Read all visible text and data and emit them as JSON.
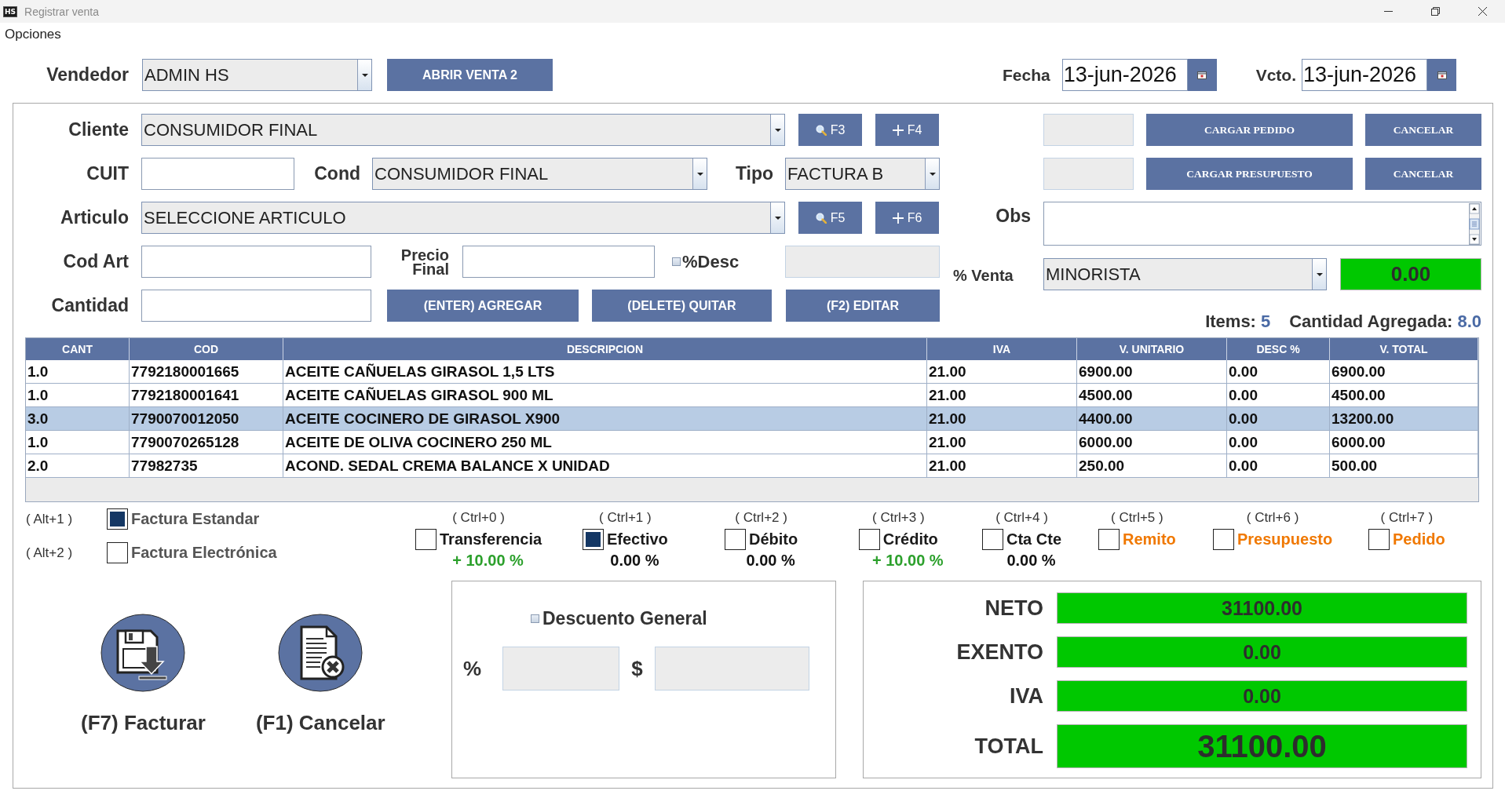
{
  "window": {
    "logo": "HS",
    "title": "Registrar venta"
  },
  "menu": [
    {
      "label": "Opciones"
    }
  ],
  "header": {
    "seller": {
      "label": "Vendedor",
      "value": "ADMIN HS"
    },
    "open_sale_button": "ABRIR VENTA 2",
    "dates": [
      {
        "label": "Fecha",
        "value": "13-jun-2026"
      },
      {
        "label": "Vcto.",
        "value": "13-jun-2026"
      }
    ]
  },
  "form": {
    "customer": {
      "label": "Cliente",
      "value": "CONSUMIDOR FINAL",
      "buttons": [
        {
          "kind": "search",
          "label": "F3"
        },
        {
          "kind": "add",
          "label": "F4"
        }
      ]
    },
    "cuit": {
      "label": "CUIT"
    },
    "condition": {
      "label": "Cond",
      "value": "CONSUMIDOR FINAL"
    },
    "type": {
      "label": "Tipo",
      "value": "FACTURA B"
    },
    "article": {
      "label": "Articulo",
      "value": "SELECCIONE ARTICULO",
      "buttons": [
        {
          "kind": "search",
          "label": "F5"
        },
        {
          "kind": "add",
          "label": "F6"
        }
      ]
    },
    "article_code": {
      "label": "Cod Art"
    },
    "final_price": {
      "label": "Precio Final"
    },
    "discount_toggle": {
      "label": "%Desc",
      "checked": false
    },
    "quantity": {
      "label": "Cantidad"
    },
    "actions": [
      "(ENTER) AGREGAR",
      "(DELETE) QUITAR",
      "(F2) EDITAR"
    ]
  },
  "loaders": [
    {
      "button": "CARGAR PEDIDO",
      "cancel": "CANCELAR"
    },
    {
      "button": "CARGAR PRESUPUESTO",
      "cancel": "CANCELAR"
    }
  ],
  "notes": {
    "label": "Obs"
  },
  "price_list": {
    "label": "% Venta",
    "value": "MINORISTA",
    "amount": "0.00"
  },
  "summary": [
    {
      "label": "Items:",
      "value": "5"
    },
    {
      "label": "Cantidad Agregada:",
      "value": "8.0"
    }
  ],
  "table": {
    "columns": [
      "CANT",
      "COD",
      "DESCRIPCION",
      "IVA",
      "V. UNITARIO",
      "DESC %",
      "V. TOTAL"
    ],
    "rows": [
      {
        "selected": false,
        "cells": [
          "1.0",
          "7792180001665",
          "ACEITE CAÑUELAS GIRASOL 1,5 LTS",
          "21.00",
          "6900.00",
          "0.00",
          "6900.00"
        ]
      },
      {
        "selected": false,
        "cells": [
          "1.0",
          "7792180001641",
          "ACEITE CAÑUELAS GIRASOL 900 ML",
          "21.00",
          "4500.00",
          "0.00",
          "4500.00"
        ]
      },
      {
        "selected": true,
        "cells": [
          "3.0",
          "7790070012050",
          "ACEITE COCINERO DE GIRASOL X900",
          "21.00",
          "4400.00",
          "0.00",
          "13200.00"
        ]
      },
      {
        "selected": false,
        "cells": [
          "1.0",
          "7790070265128",
          "ACEITE DE OLIVA COCINERO 250 ML",
          "21.00",
          "6000.00",
          "0.00",
          "6000.00"
        ]
      },
      {
        "selected": false,
        "cells": [
          "2.0",
          "77982735",
          "ACOND. SEDAL CREMA BALANCE X UNIDAD",
          "21.00",
          "250.00",
          "0.00",
          "500.00"
        ]
      }
    ]
  },
  "invoice_types": [
    {
      "shortcut": "( Alt+1 )",
      "label": "Factura Estandar",
      "checked": true
    },
    {
      "shortcut": "( Alt+2 )",
      "label": "Factura Electrónica",
      "checked": false
    }
  ],
  "payment_options": [
    {
      "kind": "payment",
      "shortcut": "( Ctrl+0 )",
      "label": "Transferencia",
      "checked": false,
      "adjustment": {
        "text": "+ 10.00 %",
        "color": "#2ca02c"
      }
    },
    {
      "kind": "payment",
      "shortcut": "( Ctrl+1 )",
      "label": "Efectivo",
      "checked": true,
      "adjustment": {
        "text": "0.00 %",
        "color": "#111111"
      }
    },
    {
      "kind": "payment",
      "shortcut": "( Ctrl+2 )",
      "label": "Débito",
      "checked": false,
      "adjustment": {
        "text": "0.00 %",
        "color": "#111111"
      }
    },
    {
      "kind": "payment",
      "shortcut": "( Ctrl+3 )",
      "label": "Crédito",
      "checked": false,
      "adjustment": {
        "text": "+ 10.00 %",
        "color": "#2ca02c"
      }
    },
    {
      "kind": "payment",
      "shortcut": "( Ctrl+4 )",
      "label": "Cta Cte",
      "checked": false,
      "adjustment": {
        "text": "0.00 %",
        "color": "#111111"
      }
    },
    {
      "kind": "document",
      "shortcut": "( Ctrl+5 )",
      "label": "Remito",
      "checked": false
    },
    {
      "kind": "document",
      "shortcut": "( Ctrl+6 )",
      "label": "Presupuesto",
      "checked": false
    },
    {
      "kind": "document",
      "shortcut": "( Ctrl+7 )",
      "label": "Pedido",
      "checked": false
    }
  ],
  "bottom_actions": [
    {
      "kind": "invoice",
      "label": "(F7) Facturar"
    },
    {
      "kind": "cancel",
      "label": "(F1) Cancelar"
    }
  ],
  "general_discount": {
    "label": "Descuento General",
    "checked": false,
    "percent_label": "%",
    "amount_label": "$"
  },
  "totals": [
    {
      "kind": "line",
      "label": "NETO",
      "value": "31100.00"
    },
    {
      "kind": "line",
      "label": "EXENTO",
      "value": "0.00"
    },
    {
      "kind": "line",
      "label": "IVA",
      "value": "0.00"
    },
    {
      "kind": "grand",
      "label": "TOTAL",
      "value": "31100.00"
    }
  ]
}
